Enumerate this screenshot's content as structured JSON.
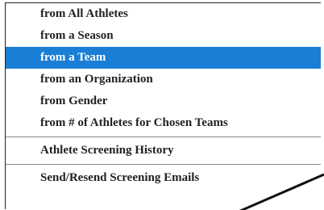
{
  "menu": {
    "items": [
      {
        "label": "from All Athletes"
      },
      {
        "label": "from a Season"
      },
      {
        "label": "from a Team",
        "selected": true
      },
      {
        "label": "from an Organization"
      },
      {
        "label": "from Gender"
      },
      {
        "label": "from # of Athletes for Chosen Teams"
      }
    ],
    "history": {
      "label": "Athlete Screening History"
    },
    "send": {
      "label": "Send/Resend Screening Emails"
    }
  },
  "colors": {
    "highlight": "#1a7ed4",
    "text": "#222222",
    "separator": "#8a8a8a",
    "annotation_line": "#111111"
  }
}
